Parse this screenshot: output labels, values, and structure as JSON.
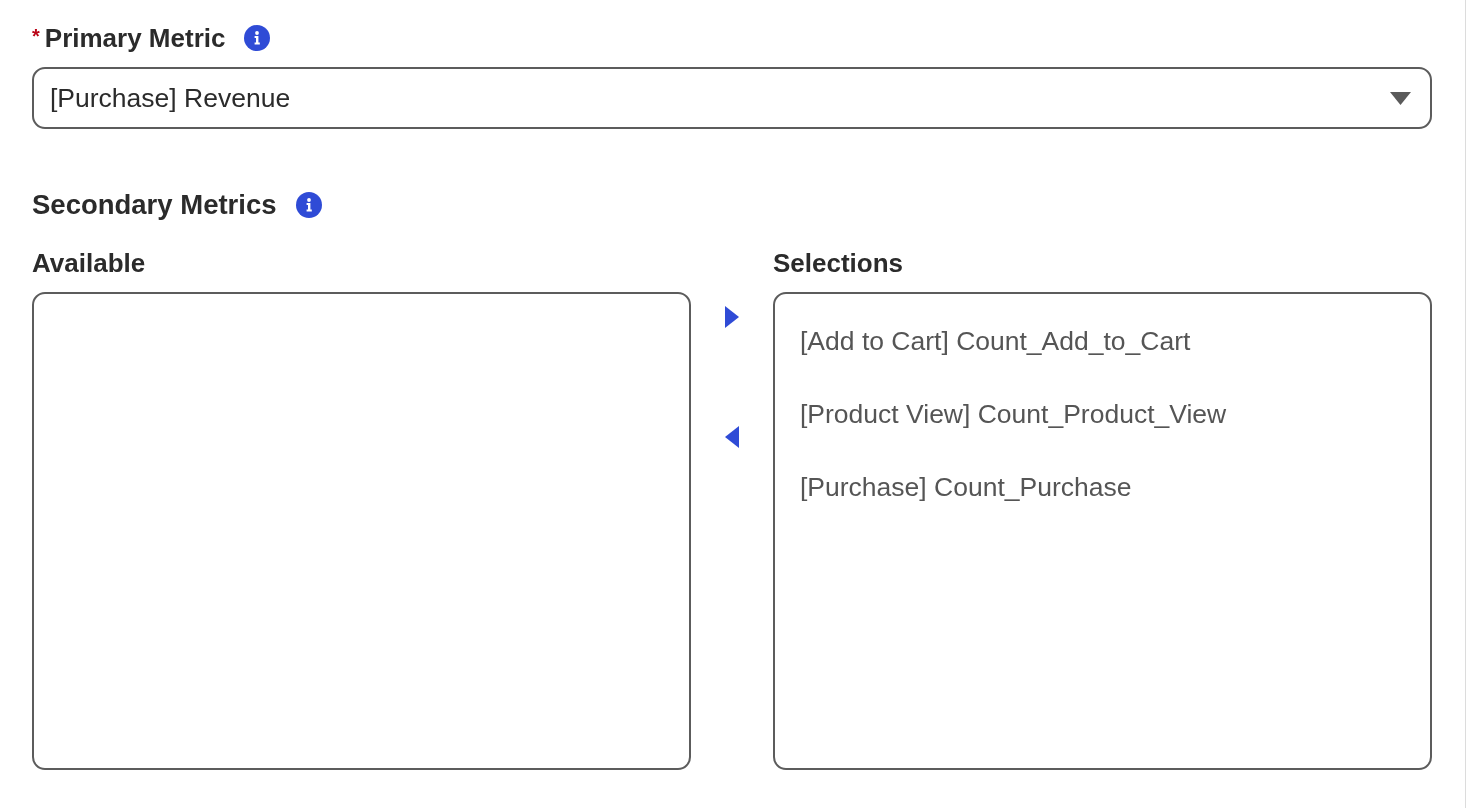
{
  "primary_metric": {
    "required_marker": "*",
    "label": "Primary Metric",
    "value": "[Purchase] Revenue"
  },
  "secondary_metrics": {
    "label": "Secondary Metrics",
    "available": {
      "label": "Available"
    },
    "selections": {
      "label": "Selections",
      "items": [
        {
          "label": "[Add to Cart] Count_Add_to_Cart",
          "selected": false
        },
        {
          "label": "[Product View] Count_Product_View",
          "selected": false
        },
        {
          "label": "[Purchase] Count_Purchase",
          "selected": false
        }
      ]
    }
  }
}
